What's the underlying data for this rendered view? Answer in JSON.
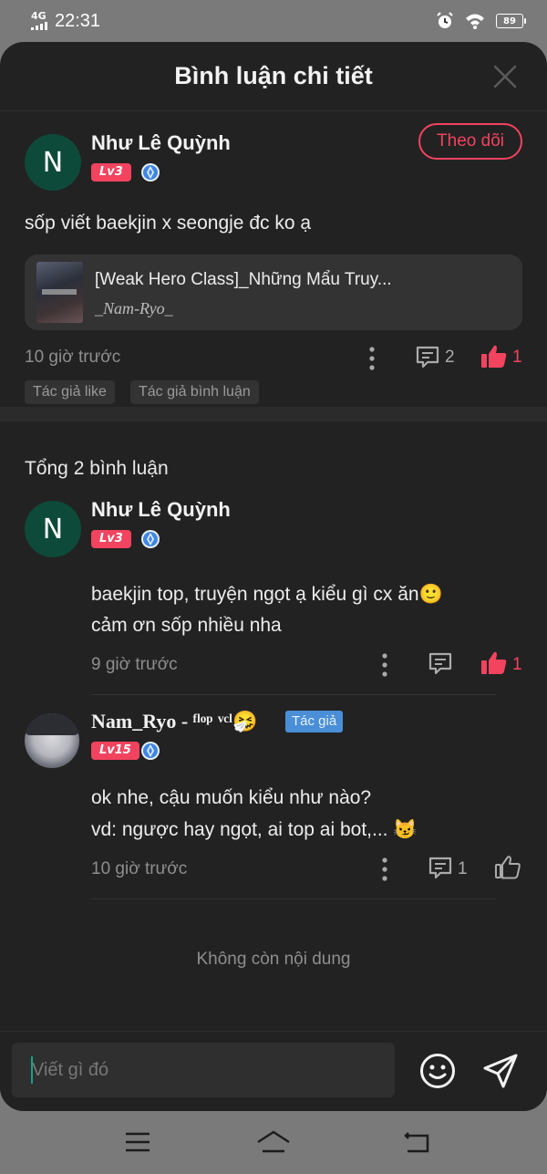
{
  "status_bar": {
    "network": "4G",
    "time": "22:31",
    "battery": "89"
  },
  "header": {
    "title": "Bình luận chi tiết"
  },
  "main_comment": {
    "avatar_letter": "N",
    "username": "Như Lê Quỳnh",
    "level": "Lv3",
    "follow_label": "Theo dõi",
    "text": "sốp viết baekjin x seongje đc ko ạ",
    "story": {
      "title": "[Weak Hero Class]_Những Mẩu Truy...",
      "author": "_Nam-Ryo_"
    },
    "time": "10 giờ trước",
    "reply_count": "2",
    "like_count": "1",
    "tags": [
      "Tác giả like",
      "Tác giả bình luận"
    ]
  },
  "replies_section": {
    "total_label": "Tổng 2 bình luận",
    "replies": [
      {
        "avatar_letter": "N",
        "username": "Như Lê Quỳnh",
        "level": "Lv3",
        "text_line1": "baekjin top, truyện ngọt ạ kiểu gì cx ăn🙂",
        "text_line2": "cảm ơn sốp nhiều nha",
        "time": "9 giờ trước",
        "reply_count": "",
        "like_count": "1"
      },
      {
        "username": "Nam_Ryo - ᶠˡᵒᵖ ᵛᶜˡ🤧",
        "author_badge": "Tác giả",
        "level": "Lv15",
        "text_line1": "ok nhe, cậu muốn kiểu như nào?",
        "text_line2": "vd: ngược hay ngọt, ai top ai bot,... 😼",
        "time": "10 giờ trước",
        "reply_count": "1",
        "like_count": ""
      }
    ],
    "end_label": "Không còn nội dung"
  },
  "input": {
    "placeholder": "Viết gì đó"
  },
  "colors": {
    "accent": "#f2435f",
    "background": "#222222",
    "author_badge": "#4a8ed7"
  },
  "icons": [
    "signal-icon",
    "alarm-icon",
    "wifi-icon",
    "battery-icon",
    "close-icon",
    "vip-diamond-icon",
    "more-icon",
    "comment-icon",
    "like-icon",
    "emoji-icon",
    "send-icon",
    "menu-icon",
    "home-icon",
    "back-icon"
  ]
}
